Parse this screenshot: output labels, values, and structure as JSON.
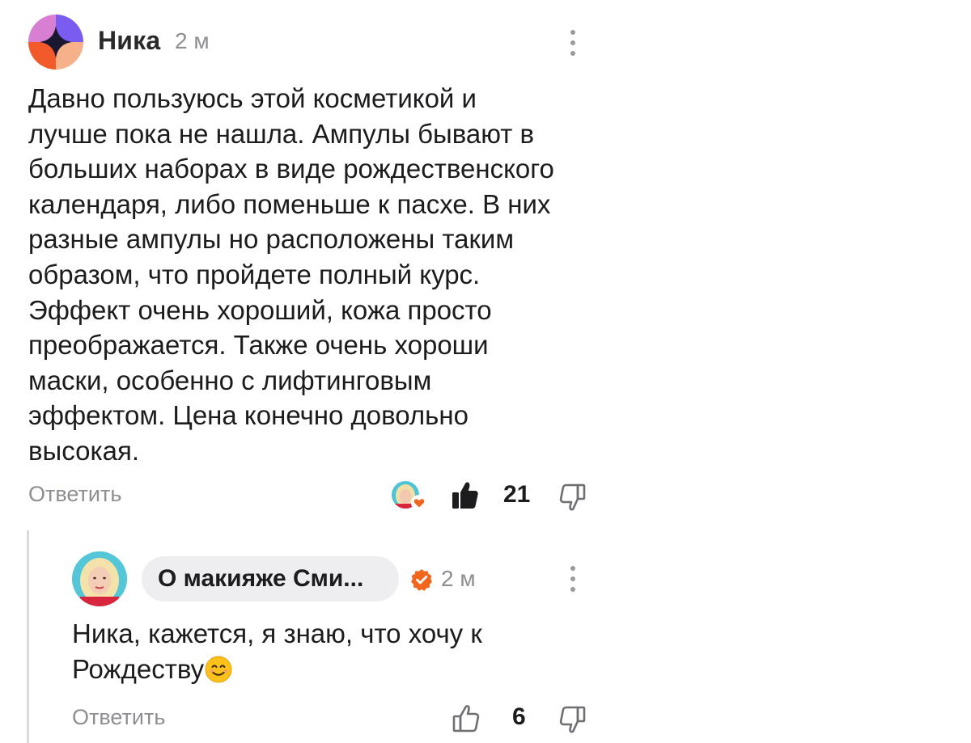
{
  "comment": {
    "author": "Ника",
    "time": "2 м",
    "text": "Давно пользуюсь этой косметикой и\nлучше пока не нашла. Ампулы бывают в\nбольших наборах в виде рождественского\nкалендаря, либо поменьше к пасхе. В них\nразные ампулы но расположены таким\nобразом, что пройдете полный курс.\nЭффект очень хороший, кожа просто\nпреображается. Также очень хороши\nмаски, особенно с лифтинговым\nэффектом. Цена конечно довольно\nвысокая.",
    "reply_label": "Ответить",
    "likes": "21",
    "liked_by_author": true
  },
  "reply": {
    "author": "О макияже Сми...",
    "verified": true,
    "time": "2 м",
    "text": "Ника, кажется, я знаю, что хочу к\nРождеству",
    "emoji": "smiling-face-icon",
    "reply_label": "Ответить",
    "likes": "6"
  },
  "colors": {
    "accent_orange": "#f2651d",
    "muted_text": "#8e8e93",
    "chip_bg": "#eeeef0",
    "thread_line": "#dadadd"
  }
}
